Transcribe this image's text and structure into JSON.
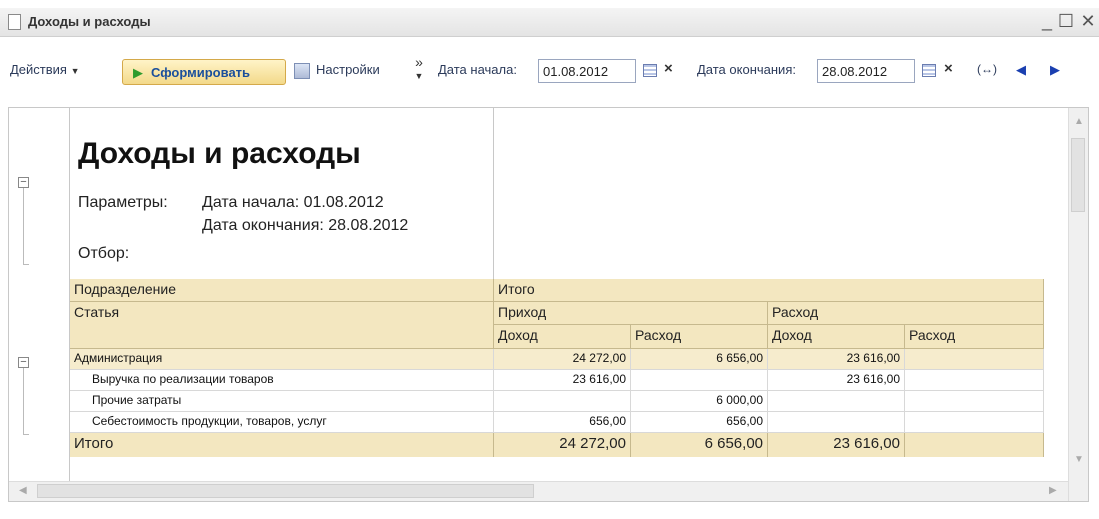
{
  "window": {
    "title": "Доходы и расходы",
    "controls": [
      "_",
      "☐",
      "✕"
    ]
  },
  "toolbar": {
    "actions_label": "Действия",
    "generate_label": "Сформировать",
    "settings_label": "Настройки",
    "more_label": "»",
    "start_date_label": "Дата начала:",
    "start_date_value": "01.08.2012",
    "end_date_label": "Дата окончания:",
    "end_date_value": "28.08.2012",
    "period_icon": "(↔)",
    "prev_icon": "◀",
    "next_icon": "▶"
  },
  "report": {
    "title": "Доходы и расходы",
    "params_label": "Параметры:",
    "param_start": "Дата начала: 01.08.2012",
    "param_end": "Дата окончания: 28.08.2012",
    "filter_label": "Отбор:",
    "header": {
      "division": "Подразделение",
      "article": "Статья",
      "total": "Итого",
      "income": "Приход",
      "expense": "Расход",
      "sub_income": "Доход",
      "sub_expense": "Расход",
      "sub_income2": "Доход",
      "sub_expense2": "Расход"
    },
    "rows": [
      {
        "name": "Администрация",
        "c1": "24 272,00",
        "c2": "6 656,00",
        "c3": "23 616,00",
        "c4": ""
      },
      {
        "name": "Выручка по реализации товаров",
        "c1": "23 616,00",
        "c2": "",
        "c3": "23 616,00",
        "c4": ""
      },
      {
        "name": "Прочие затраты",
        "c1": "",
        "c2": "6 000,00",
        "c3": "",
        "c4": ""
      },
      {
        "name": "Себестоимость продукции, товаров, услуг",
        "c1": "656,00",
        "c2": "656,00",
        "c3": "",
        "c4": ""
      }
    ],
    "total_row": {
      "name": "Итого",
      "c1": "24 272,00",
      "c2": "6 656,00",
      "c3": "23 616,00",
      "c4": ""
    }
  }
}
